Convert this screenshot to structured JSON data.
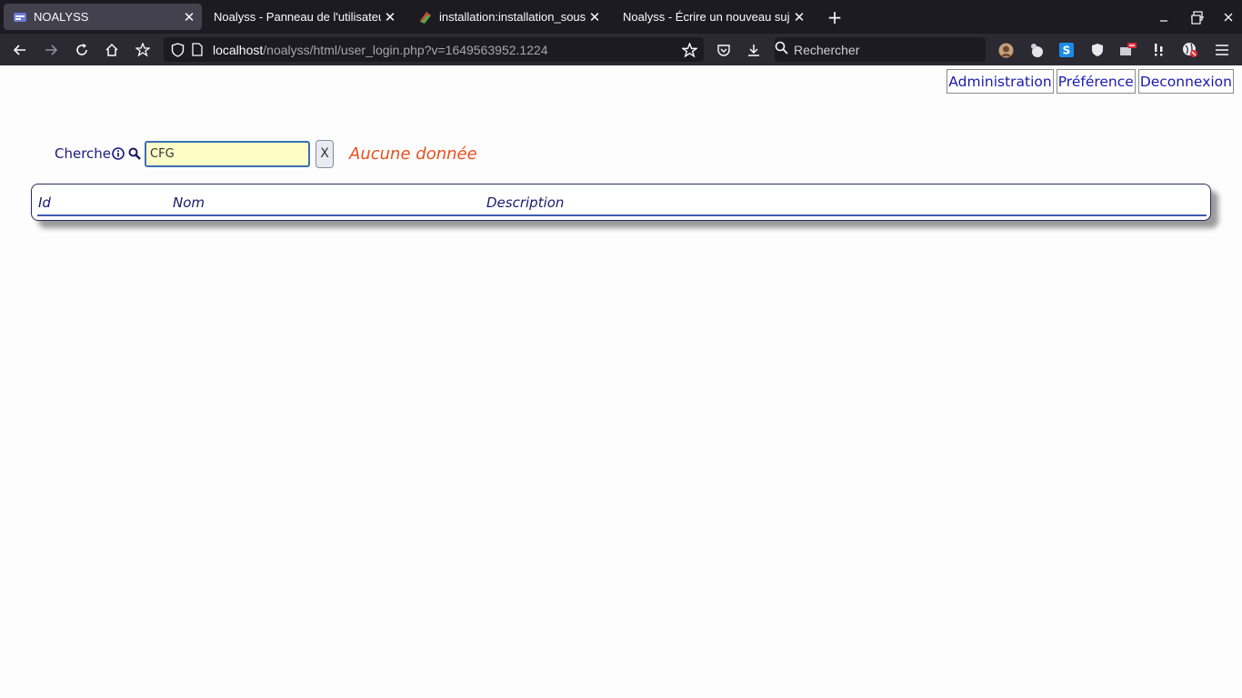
{
  "browser": {
    "tabs": [
      {
        "title": "NOALYSS",
        "active": true,
        "icon": "noalyss-favicon"
      },
      {
        "title": "Noalyss - Panneau de l'utilisateur",
        "active": false,
        "icon": "none"
      },
      {
        "title": "installation:installation_sous_windows",
        "active": false,
        "icon": "wiki-favicon"
      },
      {
        "title": "Noalyss - Écrire un nouveau sujet",
        "active": false,
        "icon": "none"
      }
    ],
    "new_tab": "+",
    "url_host": "localhost",
    "url_path": "/noalyss/html/user_login.php?v=1649563952.1224",
    "search_placeholder": "Rechercher",
    "colors": {
      "tabbar": "#1c1b22",
      "navbar": "#2b2a33",
      "active_tab": "#42414d"
    }
  },
  "page": {
    "menu": {
      "administration": "Administration",
      "preference": "Préférence",
      "deconnexion": "Deconnexion"
    },
    "search": {
      "label": "Cherche",
      "value": "CFG",
      "clear_label": "X",
      "no_data": "Aucune donnée"
    },
    "table": {
      "columns": [
        "Id",
        "Nom",
        "Description"
      ]
    },
    "colors": {
      "link": "#1a1ab0",
      "no_data": "#e8501f",
      "input_bg": "#fefdc8",
      "header_line": "#3c5bb0"
    }
  }
}
